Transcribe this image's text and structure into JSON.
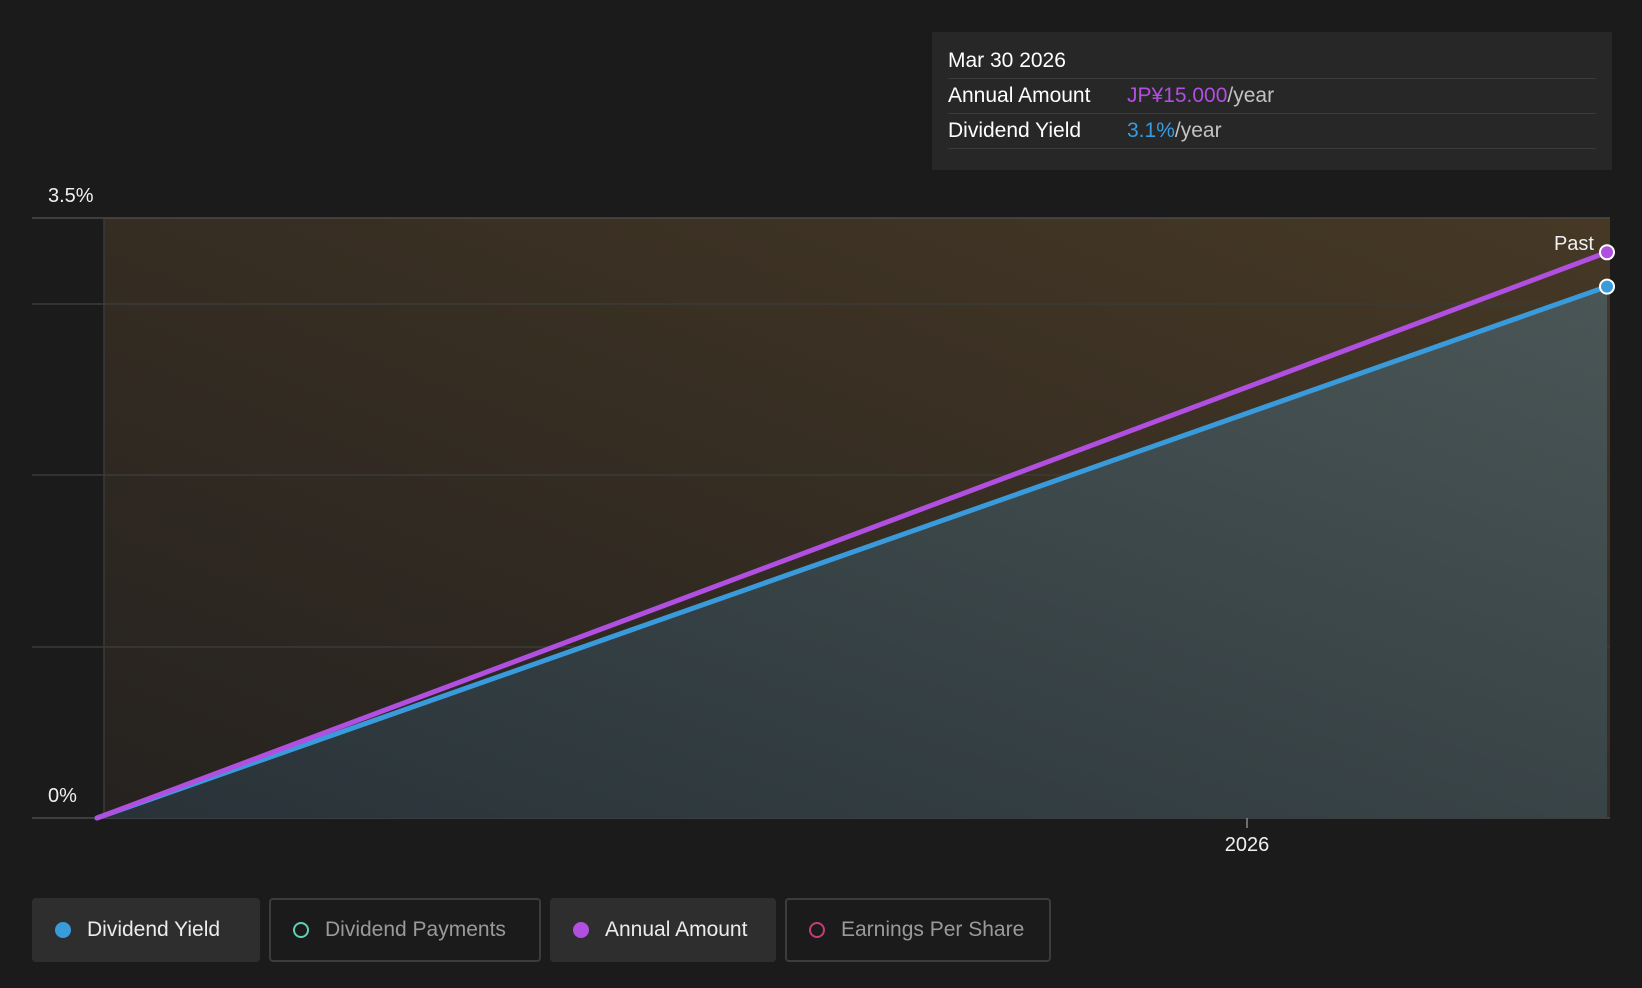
{
  "chart_data": {
    "type": "line",
    "y_axis": {
      "top_label": "3.5%",
      "bottom_label": "0%",
      "ylim": [
        0,
        3.5
      ]
    },
    "x_axis": {
      "tick_labels": [
        "2026"
      ]
    },
    "region_label": "Past",
    "series": [
      {
        "name": "Dividend Yield",
        "color": "#3a9bdc",
        "start_value": 0,
        "end_value": 3.1
      },
      {
        "name": "Annual Amount",
        "color": "#b04fe0",
        "start_value": 0,
        "end_value": 3.3
      }
    ],
    "grid": true
  },
  "tooltip": {
    "date": "Mar 30 2026",
    "rows": [
      {
        "label": "Annual Amount",
        "value": "JP¥15.000",
        "unit": "/year"
      },
      {
        "label": "Dividend Yield",
        "value": "3.1%",
        "unit": "/year"
      }
    ]
  },
  "legend": [
    {
      "label": "Dividend Yield",
      "color": "#3a9bdc",
      "active": true,
      "icon": "filled-dot-icon"
    },
    {
      "label": "Dividend Payments",
      "color": "#5fd0b8",
      "active": false,
      "icon": "hollow-dot-icon"
    },
    {
      "label": "Annual Amount",
      "color": "#b04fe0",
      "active": true,
      "icon": "filled-dot-icon"
    },
    {
      "label": "Earnings Per Share",
      "color": "#c43d7a",
      "active": false,
      "icon": "hollow-dot-icon"
    }
  ]
}
